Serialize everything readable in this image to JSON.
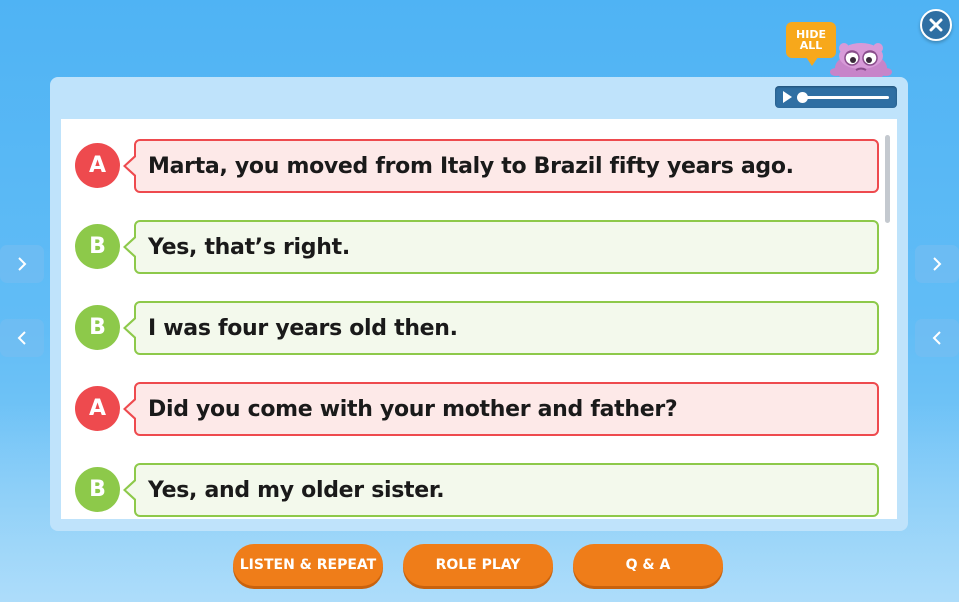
{
  "header": {
    "close_icon": "close-icon",
    "hide_all_label": "HIDE ALL",
    "mascot": "purple-monster-mascot"
  },
  "audio_player": {
    "play_icon": "play-icon",
    "progress": 0
  },
  "dialog": [
    {
      "speaker": "A",
      "text": "Marta, you moved from Italy to Brazil fifty years ago."
    },
    {
      "speaker": "B",
      "text": "Yes, that’s right."
    },
    {
      "speaker": "B",
      "text": "I was four years old then."
    },
    {
      "speaker": "A",
      "text": "Did you come with your mother and father?"
    },
    {
      "speaker": "B",
      "text": "Yes, and my older sister."
    }
  ],
  "nav": {
    "next_icon": "chevron-right-icon",
    "prev_icon": "chevron-left-icon"
  },
  "buttons": {
    "listen_repeat": "LISTEN & REPEAT",
    "role_play": "ROLE PLAY",
    "qa": "Q & A"
  },
  "colors": {
    "speaker_a": "#ee4a4e",
    "speaker_b": "#8dc94a",
    "button": "#ef7d19",
    "hide_all": "#f7a81b"
  }
}
